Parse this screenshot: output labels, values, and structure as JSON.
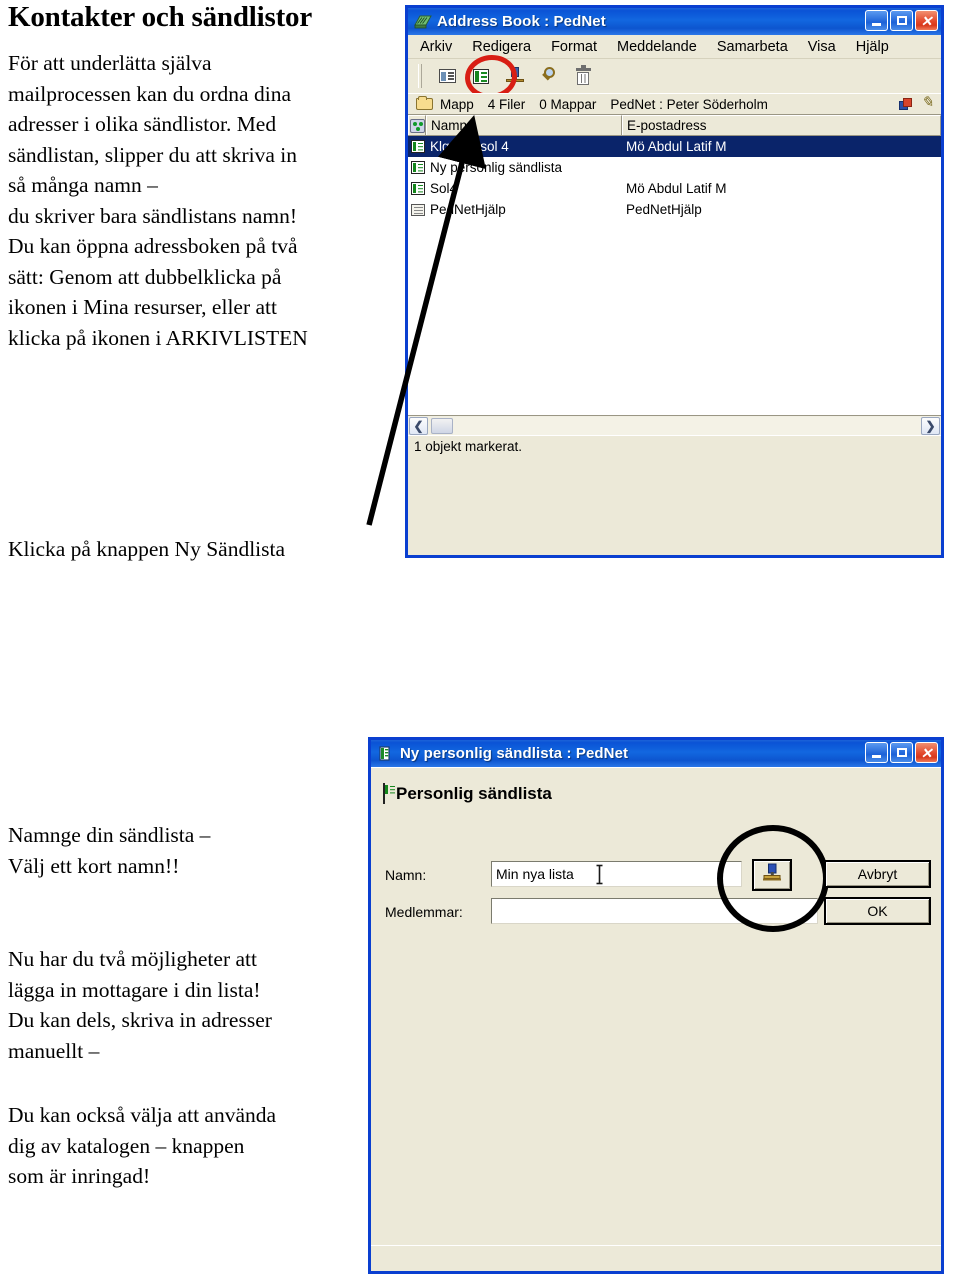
{
  "document": {
    "title": "Kontakter och sändlistor",
    "paragraphs": {
      "intro": [
        "För att underlätta själva",
        "mailprocessen kan du ordna dina",
        "adresser i olika sändlistor. Med",
        "sändlistan, slipper du att skriva in",
        "så många namn –",
        "du skriver bara sändlistans namn!",
        "Du kan öppna adressboken på två",
        "sätt: Genom att dubbelklicka på",
        "ikonen i Mina resurser, eller att",
        "klicka på ikonen i ARKIVLISTEN"
      ],
      "klicka": [
        "Klicka på knappen Ny Sändlista"
      ],
      "namnge": [
        "Namnge din sändlista –",
        "Välj ett kort namn!!"
      ],
      "mottagare": [
        "Nu har du två möjligheter att",
        "lägga in mottagare i din lista!",
        "Du kan dels, skriva in adresser",
        "manuellt –"
      ],
      "katalog": [
        "Du kan också välja att använda",
        "dig av katalogen – knappen",
        "som är inringad!"
      ]
    }
  },
  "address_book_window": {
    "title": "Address Book : PedNet",
    "window_buttons": {
      "minimize": "_",
      "maximize": "□",
      "close": "✕"
    },
    "menu": [
      "Arkiv",
      "Redigera",
      "Format",
      "Meddelande",
      "Samarbeta",
      "Visa",
      "Hjälp"
    ],
    "toolbar": [
      {
        "name": "new-contact-icon",
        "label": ""
      },
      {
        "name": "new-group-list-icon",
        "label": ""
      },
      {
        "name": "stamp-icon",
        "label": ""
      },
      {
        "name": "search-icon",
        "label": ""
      },
      {
        "name": "delete-icon",
        "label": ""
      }
    ],
    "infobar": {
      "folder": "Mapp",
      "files": "4 Filer",
      "folders": "0 Mappar",
      "path": "PedNet : Peter Söderholm"
    },
    "columns": [
      "Namn",
      "E-postadress"
    ],
    "rows": [
      {
        "name": "Klgrupp sol 4",
        "email": "Mö Abdul Latif M",
        "selected": true,
        "icon": "group-list-icon"
      },
      {
        "name": "Ny personlig sändlista",
        "email": "",
        "selected": false,
        "icon": "group-list-icon"
      },
      {
        "name": "Sol4",
        "email": "Mö Abdul Latif M",
        "selected": false,
        "icon": "group-list-icon"
      },
      {
        "name": "PedNetHjälp",
        "email": "PedNetHjälp",
        "selected": false,
        "icon": "plain-list-icon"
      }
    ],
    "scrollbar": {
      "left_arrow": "❮",
      "right_arrow": "❯"
    },
    "status": "1 objekt markerat."
  },
  "new_list_dialog": {
    "title": "Ny personlig sändlista : PedNet",
    "window_buttons": {
      "minimize": "_",
      "maximize": "□",
      "close": "✕"
    },
    "heading": "Personlig sändlista",
    "fields": [
      {
        "label": "Namn:",
        "value": "Min nya lista",
        "placeholder": ""
      },
      {
        "label": "Medlemmar:",
        "value": "",
        "placeholder": ""
      }
    ],
    "buttons": {
      "cancel": "Avbryt",
      "ok": "OK",
      "directory": ""
    }
  },
  "annotations": {
    "red_circle": "highlights the Ny Sändlista toolbar button",
    "black_circle": "highlights the katalog (directory) button",
    "arrow": "points from the Klicka på knappen Ny Sändlista text to the toolbar button"
  },
  "colors": {
    "title_bar_blue": "#0a53d6",
    "window_border_blue": "#0a3fd0",
    "dialog_face": "#ece9d8",
    "selection_blue": "#0a246a",
    "red_highlight": "#d81e14",
    "black_highlight": "#000000",
    "close_button_red": "#e2472a"
  }
}
